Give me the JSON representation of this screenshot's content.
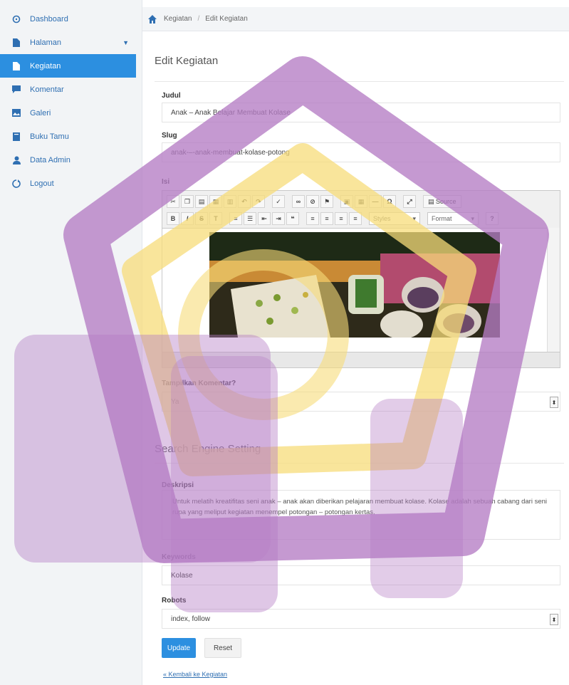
{
  "sidebar": {
    "items": [
      {
        "label": "Dashboard",
        "icon": "dashboard-icon",
        "active": false
      },
      {
        "label": "Halaman",
        "icon": "file-icon",
        "active": false
      },
      {
        "label": "Kegiatan",
        "icon": "file-icon",
        "active": true
      },
      {
        "label": "Komentar",
        "icon": "comment-icon",
        "active": false
      },
      {
        "label": "Galeri",
        "icon": "image-icon",
        "active": false
      },
      {
        "label": "Buku Tamu",
        "icon": "book-icon",
        "active": false
      },
      {
        "label": "Data Admin",
        "icon": "user-icon",
        "active": false
      },
      {
        "label": "Logout",
        "icon": "logout-icon",
        "active": false
      }
    ]
  },
  "breadcrumb": {
    "items": [
      "Kegiatan",
      "Edit Kegiatan"
    ]
  },
  "page": {
    "title": "Edit Kegiatan"
  },
  "form": {
    "judul": {
      "label": "Judul",
      "value": "Anak – Anak Belajar Membuat Kolase"
    },
    "slug": {
      "label": "Slug",
      "value": "anak-–-anak-membuat-kolase-potong"
    },
    "isi": {
      "label": "Isi"
    },
    "editor": {
      "styles": "Styles",
      "format": "Format",
      "source": "Source"
    },
    "komentar": {
      "label": "Tampilkan Komentar?",
      "value": "Ya"
    },
    "seo_title": "Search Engine Setting",
    "deskripsi": {
      "label": "Deskripsi",
      "value": "Untuk melatih kreatifitas seni anak – anak akan diberikan pelajaran membuat kolase. Kolase adalah sebuah cabang dari seni rupa yang meliput kegiatan menempel potongan – potongan kertas."
    },
    "keywords": {
      "label": "Keywords",
      "value": "Kolase"
    },
    "robots": {
      "label": "Robots",
      "value": "index, follow"
    },
    "update_label": "Update",
    "reset_label": "Reset",
    "back_link": "« Kembali ke Kegiatan"
  },
  "colors": {
    "accent": "#2c8fe0",
    "watermark_purple": "#b57cc4",
    "watermark_yellow": "#f7dc7a"
  }
}
